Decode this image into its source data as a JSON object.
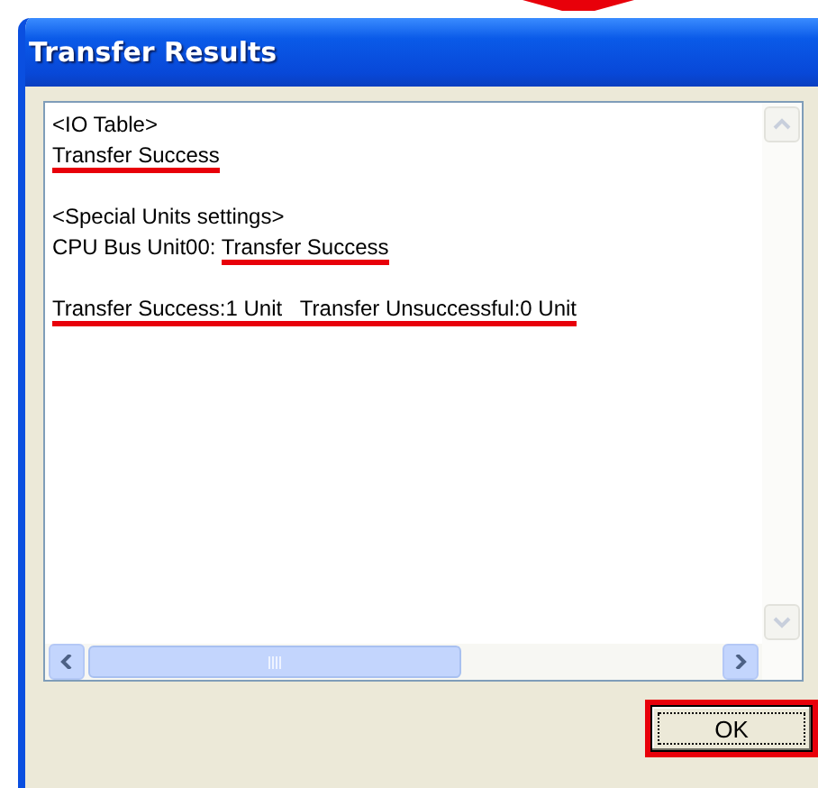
{
  "window": {
    "title": "Transfer Results"
  },
  "results": {
    "paragraphs": [
      [
        {
          "parts": [
            {
              "text": "<IO Table>",
              "underlined": false
            }
          ]
        },
        {
          "parts": [
            {
              "text": "Transfer Success",
              "underlined": true
            }
          ]
        }
      ],
      [
        {
          "parts": [
            {
              "text": "<Special Units settings>",
              "underlined": false
            }
          ]
        },
        {
          "parts": [
            {
              "text": "CPU Bus Unit00: ",
              "underlined": false
            },
            {
              "text": "Transfer Success",
              "underlined": true
            }
          ]
        }
      ],
      [
        {
          "parts": [
            {
              "text": "Transfer Success:1 Unit   Transfer Unsuccessful:0 Unit",
              "underlined": true
            }
          ]
        }
      ]
    ]
  },
  "buttons": [
    {
      "label": "OK",
      "highlighted": true
    }
  ]
}
